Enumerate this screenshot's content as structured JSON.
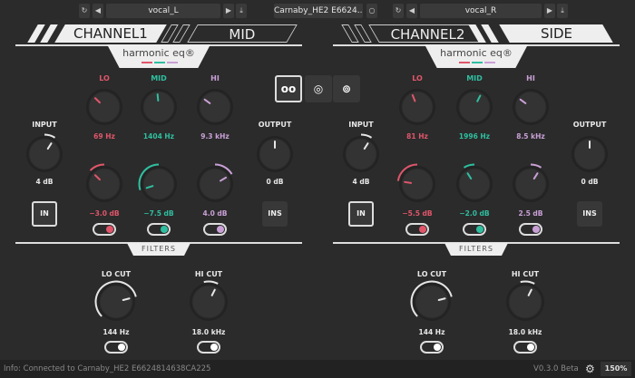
{
  "topbar": {
    "left_preset": "vocal_L",
    "device": "Carnaby_HE2 E6624...",
    "right_preset": "vocal_R"
  },
  "colors": {
    "lo": "#e0566a",
    "mid": "#2fbfa0",
    "hi": "#c9a0d6",
    "white": "#e6e6e6"
  },
  "channels": [
    {
      "name": "CHANNEL1",
      "mode": "MID",
      "input_label": "INPUT",
      "input": "4 dB",
      "input_pos": 0.62,
      "output_label": "OUTPUT",
      "output": "0 dB",
      "output_pos": 0.5,
      "in_label": "IN",
      "ins_label": "INS",
      "bands": [
        {
          "label": "LO",
          "freq": "69 Hz",
          "freq_pos": 0.33,
          "gain": "−3.0 dB",
          "gain_pos": 0.33,
          "on": true
        },
        {
          "label": "MID",
          "freq": "1404 Hz",
          "freq_pos": 0.48,
          "gain": "−7.5 dB",
          "gain_pos": 0.1,
          "on": true
        },
        {
          "label": "HI",
          "freq": "9.3 kHz",
          "freq_pos": 0.3,
          "gain": "4.0 dB",
          "gain_pos": 0.72,
          "on": true
        }
      ],
      "filters": [
        {
          "label": "LO CUT",
          "value": "144 Hz",
          "pos": 0.78,
          "on": true
        },
        {
          "label": "HI CUT",
          "value": "18.0 kHz",
          "pos": 0.6,
          "on": true
        }
      ]
    },
    {
      "name": "CHANNEL2",
      "mode": "SIDE",
      "input_label": "INPUT",
      "input": "4 dB",
      "input_pos": 0.62,
      "output_label": "OUTPUT",
      "output": "0 dB",
      "output_pos": 0.5,
      "in_label": "IN",
      "ins_label": "INS",
      "bands": [
        {
          "label": "LO",
          "freq": "81 Hz",
          "freq_pos": 0.42,
          "gain": "−5.5 dB",
          "gain_pos": 0.2,
          "on": true
        },
        {
          "label": "MID",
          "freq": "1996 Hz",
          "freq_pos": 0.6,
          "gain": "−2.0 dB",
          "gain_pos": 0.38,
          "on": true
        },
        {
          "label": "HI",
          "freq": "8.5 kHz",
          "freq_pos": 0.3,
          "gain": "2.5 dB",
          "gain_pos": 0.62,
          "on": true
        }
      ],
      "filters": [
        {
          "label": "LO CUT",
          "value": "144 Hz",
          "pos": 0.78,
          "on": true
        },
        {
          "label": "HI CUT",
          "value": "18.0 kHz",
          "pos": 0.6,
          "on": true
        }
      ]
    }
  ],
  "logo": "harmonic eq®",
  "filters_label": "FILTERS",
  "link_modes": [
    "unlinked",
    "linked",
    "stereo-linked"
  ],
  "status": {
    "info": "Info: Connected to Carnaby_HE2 E6624814638CA225",
    "version": "V0.3.0 Beta",
    "zoom": "150%"
  }
}
